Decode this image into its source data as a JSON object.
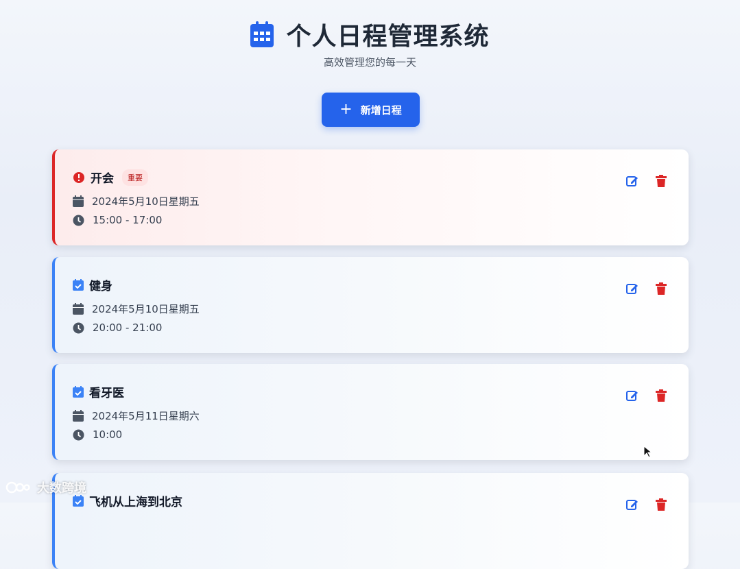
{
  "header": {
    "title": "个人日程管理系统",
    "subtitle": "高效管理您的每一天",
    "icon": "calendar-icon"
  },
  "toolbar": {
    "add_label": "新增日程",
    "add_icon": "plus-icon"
  },
  "events": [
    {
      "title": "开会",
      "important": true,
      "badge": "重要",
      "date": "2024年5月10日星期五",
      "time": "15:00 - 17:00"
    },
    {
      "title": "健身",
      "important": false,
      "date": "2024年5月10日星期五",
      "time": "20:00 - 21:00"
    },
    {
      "title": "看牙医",
      "important": false,
      "date": "2024年5月11日星期六",
      "time": "10:00"
    },
    {
      "title": "飞机从上海到北京",
      "important": false
    }
  ],
  "watermark": "大数跨境",
  "colors": {
    "accent": "#2563eb",
    "danger": "#dc2626",
    "important_border": "#dc2626",
    "normal_border": "#3b82f6"
  }
}
